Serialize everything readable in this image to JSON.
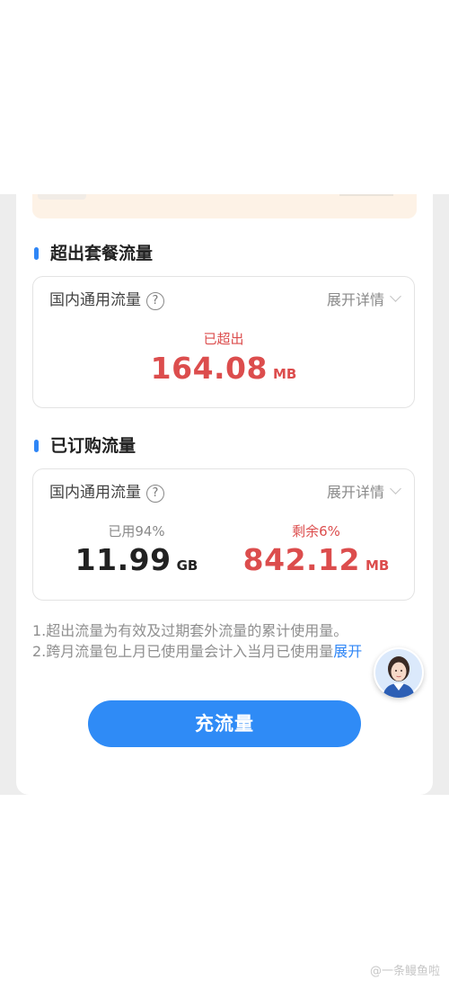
{
  "exceeded_section": {
    "title": "超出套餐流量",
    "box": {
      "label": "国内通用流量",
      "help_icon": "?",
      "detail_label": "展开详情",
      "status_label": "已超出",
      "value": "164.08",
      "unit": "MB"
    }
  },
  "purchased_section": {
    "title": "已订购流量",
    "box": {
      "label": "国内通用流量",
      "help_icon": "?",
      "detail_label": "展开详情",
      "used_label": "已用94%",
      "used_value": "11.99",
      "used_unit": "GB",
      "remaining_label": "剩余6%",
      "remaining_value": "842.12",
      "remaining_unit": "MB"
    }
  },
  "notes": {
    "line1": "1.超出流量为有效及过期套外流量的累计使用量。",
    "line2": "2.跨月流量包上月已使用量会计入当月已使用量",
    "expand_label": "展开"
  },
  "cta": {
    "label": "充流量"
  },
  "watermark": "@一条鳗鱼啦",
  "colors": {
    "accent_blue": "#2f8bf6",
    "alert_red": "#dc4d4d"
  },
  "icons": [
    "help-icon",
    "chevron-down-icon",
    "assistant-avatar"
  ]
}
